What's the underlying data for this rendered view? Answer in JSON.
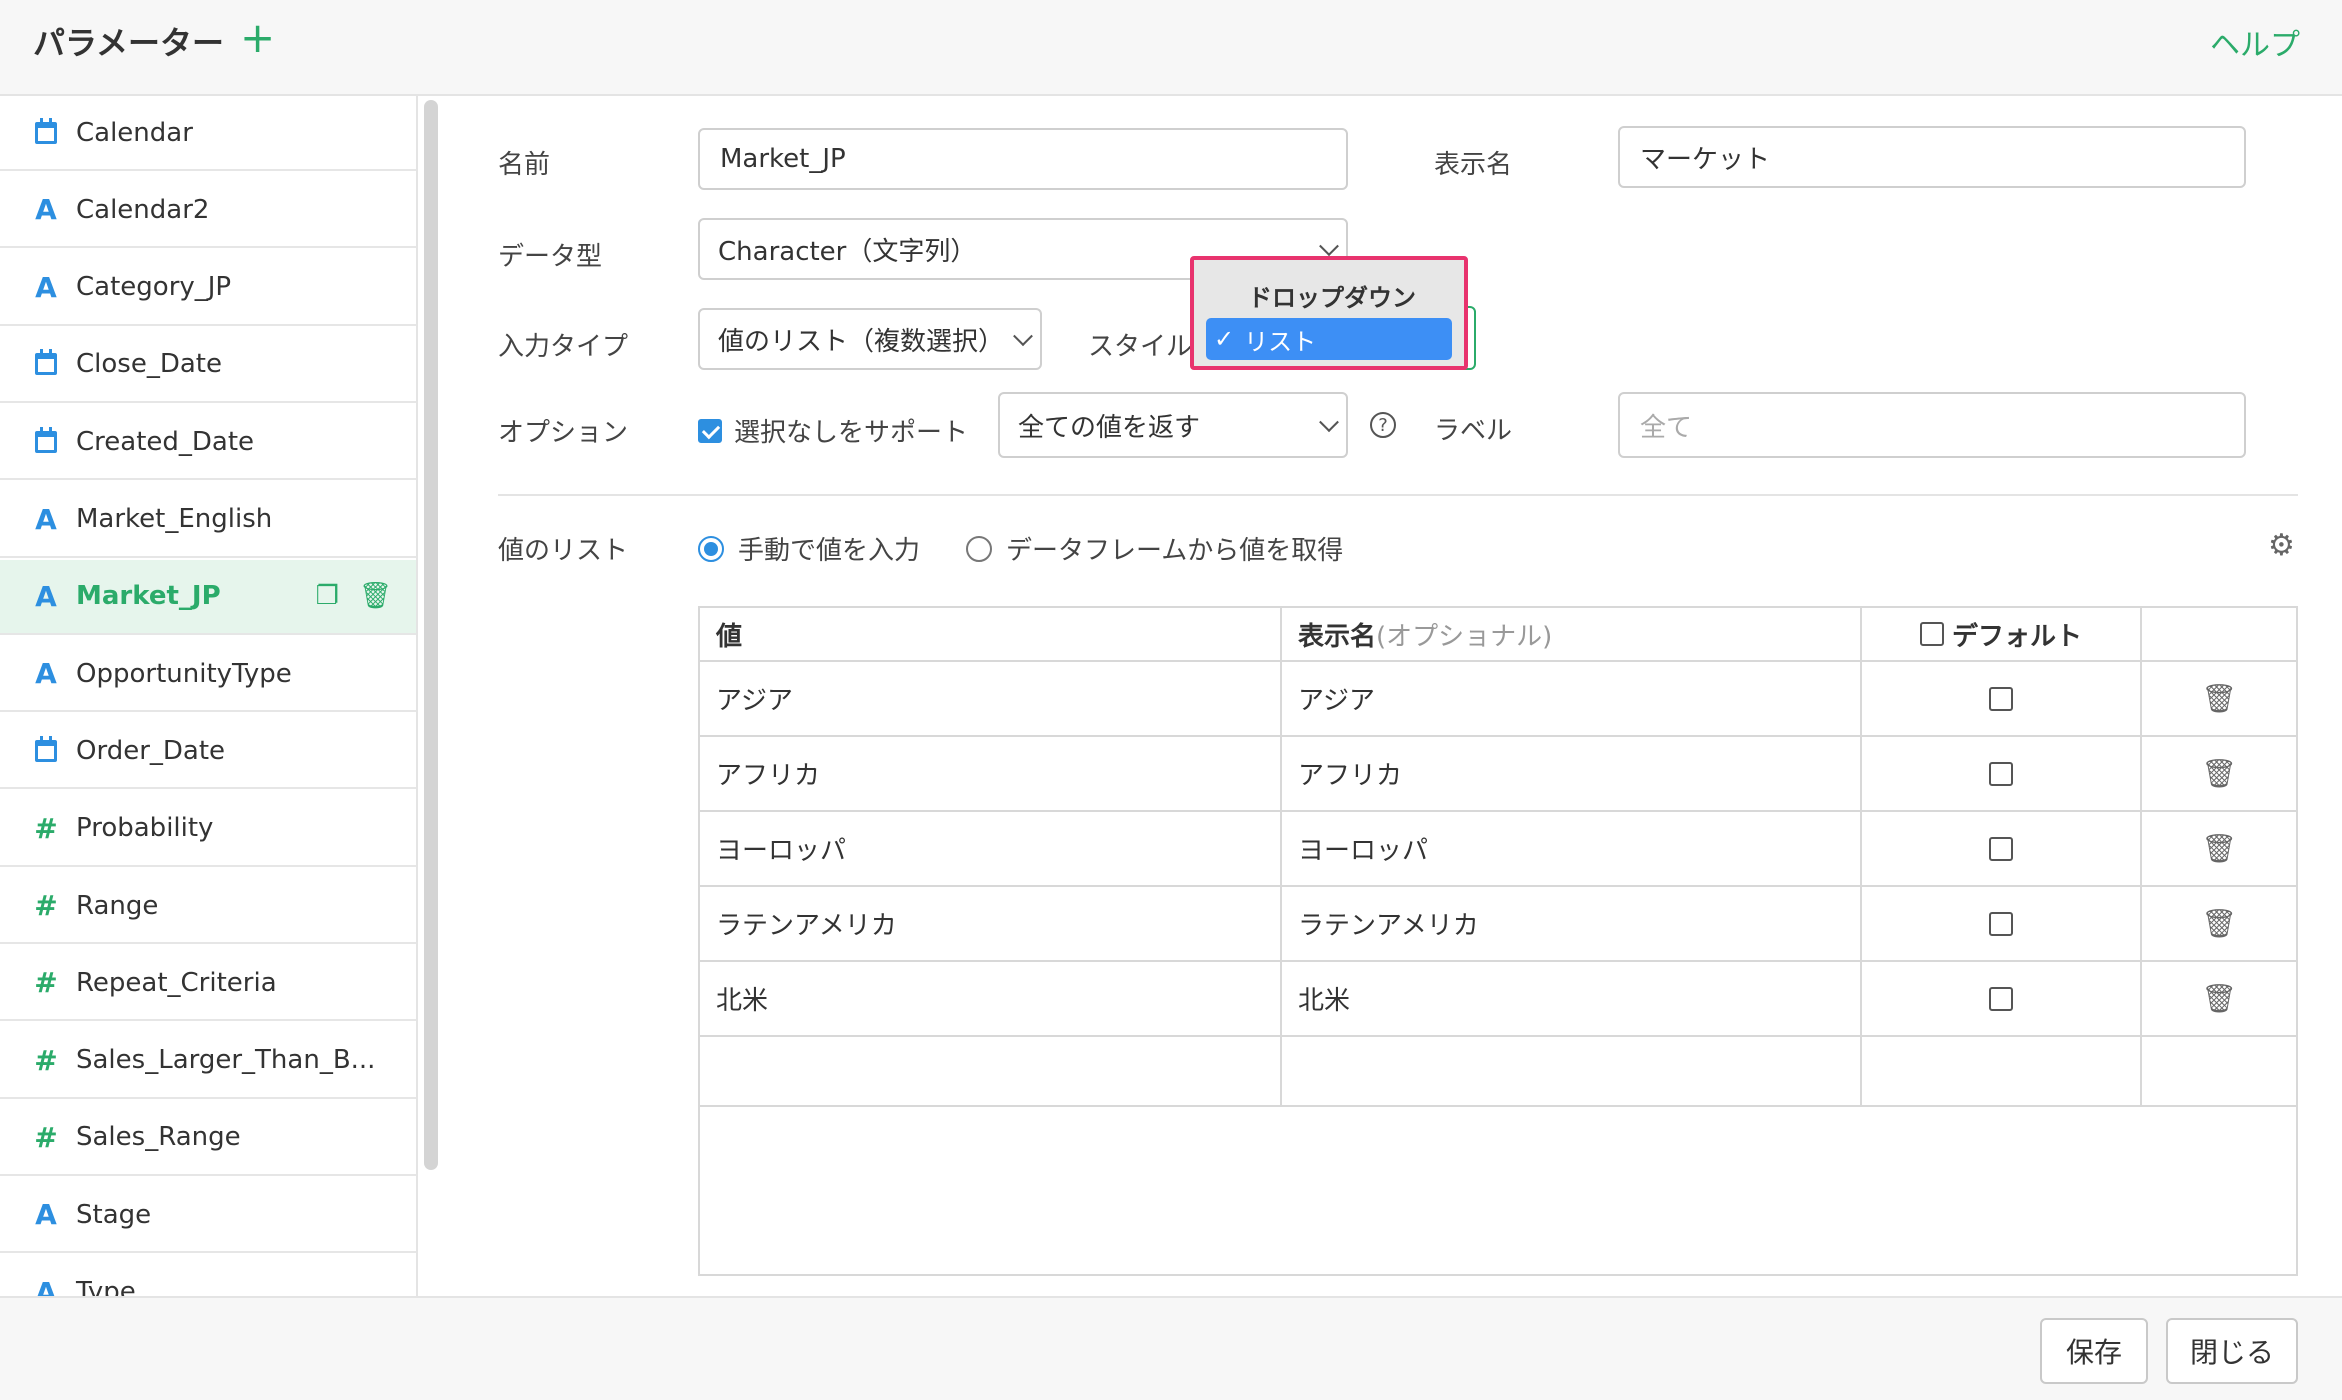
{
  "header": {
    "title": "パラメーター",
    "add_icon": "+",
    "help": "ヘルプ"
  },
  "sidebar": {
    "items": [
      {
        "icon": "calendar",
        "label": "Calendar"
      },
      {
        "icon": "A",
        "label": "Calendar2"
      },
      {
        "icon": "A",
        "label": "Category_JP"
      },
      {
        "icon": "calendar",
        "label": "Close_Date"
      },
      {
        "icon": "calendar",
        "label": "Created_Date"
      },
      {
        "icon": "A",
        "label": "Market_English"
      },
      {
        "icon": "A",
        "label": "Market_JP",
        "active": true
      },
      {
        "icon": "A",
        "label": "OpportunityType"
      },
      {
        "icon": "calendar",
        "label": "Order_Date"
      },
      {
        "icon": "#",
        "label": "Probability"
      },
      {
        "icon": "#",
        "label": "Range"
      },
      {
        "icon": "#",
        "label": "Repeat_Criteria"
      },
      {
        "icon": "#",
        "label": "Sales_Larger_Than_B..."
      },
      {
        "icon": "#",
        "label": "Sales_Range"
      },
      {
        "icon": "A",
        "label": "Stage"
      },
      {
        "icon": "A",
        "label": "Type"
      }
    ],
    "icon_glyphs": {
      "A": "A",
      "#": "#"
    }
  },
  "form": {
    "name_label": "名前",
    "name_value": "Market_JP",
    "display_name_label": "表示名",
    "display_name_value": "マーケット",
    "data_type_label": "データ型",
    "data_type_value": "Character（文字列）",
    "input_type_label": "入力タイプ",
    "input_type_value": "値のリスト（複数選択）",
    "style_label": "スタイル",
    "option_label": "オプション",
    "support_none_label": "選択なしをサポート",
    "return_value": "全ての値を返す",
    "help_icon": "?",
    "label_label": "ラベル",
    "label_placeholder": "全て"
  },
  "value_list": {
    "label": "値のリスト",
    "manual_label": "手動で値を入力",
    "from_df_label": "データフレームから値を取得",
    "gear_icon": "⚙"
  },
  "table": {
    "header_value": "値",
    "header_display": "表示名",
    "header_display_optional": "(オプショナル)",
    "header_default": "デフォルト",
    "rows": [
      {
        "value": "アジア",
        "display": "アジア"
      },
      {
        "value": "アフリカ",
        "display": "アフリカ"
      },
      {
        "value": "ヨーロッパ",
        "display": "ヨーロッパ"
      },
      {
        "value": "ラテンアメリカ",
        "display": "ラテンアメリカ"
      },
      {
        "value": "北米",
        "display": "北米"
      }
    ],
    "trash_icon": "🗑"
  },
  "popup": {
    "header": "ドロップダウン",
    "selected": "リスト",
    "check": "✓"
  },
  "footer": {
    "save": "保存",
    "close": "閉じる"
  },
  "colors": {
    "accent": "#2bab6a",
    "blue": "#2d8fe0",
    "highlight": "#e8336e",
    "select": "#3d8ff5"
  }
}
